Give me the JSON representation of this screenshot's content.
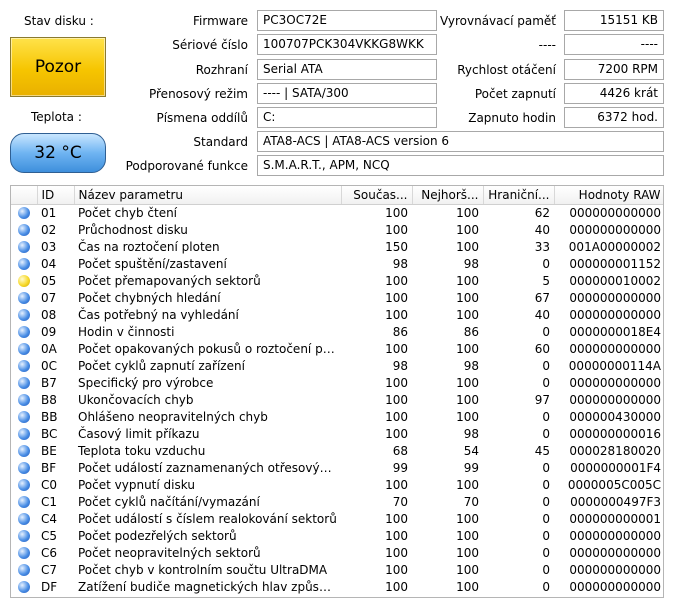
{
  "left_panel": {
    "status_label": "Stav disku :",
    "status_value": "Pozor",
    "temperature_label": "Teplota :",
    "temperature_value": "32 °C"
  },
  "info": {
    "firmware": {
      "label": "Firmware",
      "value": "PC3OC72E"
    },
    "serial": {
      "label": "Sériové číslo",
      "value": "100707PCK304VKKG8WKK"
    },
    "interface": {
      "label": "Rozhraní",
      "value": "Serial ATA"
    },
    "transfer_mode": {
      "label": "Přenosový režim",
      "value": "---- | SATA/300"
    },
    "drive_letter": {
      "label": "Písmena oddílů",
      "value": "C:"
    },
    "standard": {
      "label": "Standard",
      "value": "ATA8-ACS | ATA8-ACS version 6"
    },
    "features": {
      "label": "Podporované funkce",
      "value": "S.M.A.R.T., APM, NCQ"
    },
    "buffer": {
      "label": "Vyrovnávací paměť",
      "value": "15151 KB"
    },
    "blank_label": "----",
    "blank_value": "----",
    "rotation": {
      "label": "Rychlost otáčení",
      "value": "7200 RPM"
    },
    "power_count": {
      "label": "Počet zapnutí",
      "value": "4426 krát"
    },
    "power_hours": {
      "label": "Zapnuto hodin",
      "value": "6372 hod."
    }
  },
  "table": {
    "headers": {
      "id": "ID",
      "name": "Název parametru",
      "current": "Součas...",
      "worst": "Nejhorš...",
      "threshold": "Hraniční...",
      "raw": "Hodnoty RAW"
    },
    "rows": [
      {
        "status": "blue",
        "id": "01",
        "name": "Počet chyb čtení",
        "current": "100",
        "worst": "100",
        "threshold": "62",
        "raw": "000000000000"
      },
      {
        "status": "blue",
        "id": "02",
        "name": "Průchodnost disku",
        "current": "100",
        "worst": "100",
        "threshold": "40",
        "raw": "000000000000"
      },
      {
        "status": "blue",
        "id": "03",
        "name": "Čas na roztočení ploten",
        "current": "150",
        "worst": "100",
        "threshold": "33",
        "raw": "001A00000002"
      },
      {
        "status": "blue",
        "id": "04",
        "name": "Počet spuštění/zastavení",
        "current": "98",
        "worst": "98",
        "threshold": "0",
        "raw": "000000001152"
      },
      {
        "status": "yellow",
        "id": "05",
        "name": "Počet přemapovaných sektorů",
        "current": "100",
        "worst": "100",
        "threshold": "5",
        "raw": "000000010002"
      },
      {
        "status": "blue",
        "id": "07",
        "name": "Počet chybných hledání",
        "current": "100",
        "worst": "100",
        "threshold": "67",
        "raw": "000000000000"
      },
      {
        "status": "blue",
        "id": "08",
        "name": "Čas potřebný na vyhledání",
        "current": "100",
        "worst": "100",
        "threshold": "40",
        "raw": "000000000000"
      },
      {
        "status": "blue",
        "id": "09",
        "name": "Hodin v činnosti",
        "current": "86",
        "worst": "86",
        "threshold": "0",
        "raw": "0000000018E4"
      },
      {
        "status": "blue",
        "id": "0A",
        "name": "Počet opakovaných pokusů o roztočení plot...",
        "current": "100",
        "worst": "100",
        "threshold": "60",
        "raw": "000000000000"
      },
      {
        "status": "blue",
        "id": "0C",
        "name": "Počet cyklů zapnutí zařízení",
        "current": "98",
        "worst": "98",
        "threshold": "0",
        "raw": "00000000114A"
      },
      {
        "status": "blue",
        "id": "B7",
        "name": "Specifický pro výrobce",
        "current": "100",
        "worst": "100",
        "threshold": "0",
        "raw": "000000000000"
      },
      {
        "status": "blue",
        "id": "B8",
        "name": "Ukončovacích chyb",
        "current": "100",
        "worst": "100",
        "threshold": "97",
        "raw": "000000000000"
      },
      {
        "status": "blue",
        "id": "BB",
        "name": "Ohlášeno neopravitelných chyb",
        "current": "100",
        "worst": "100",
        "threshold": "0",
        "raw": "000000430000"
      },
      {
        "status": "blue",
        "id": "BC",
        "name": "Časový limit příkazu",
        "current": "100",
        "worst": "98",
        "threshold": "0",
        "raw": "000000000016"
      },
      {
        "status": "blue",
        "id": "BE",
        "name": "Teplota toku vzduchu",
        "current": "68",
        "worst": "54",
        "threshold": "45",
        "raw": "000028180020"
      },
      {
        "status": "blue",
        "id": "BF",
        "name": "Počet událostí zaznamenaných otřesovým ...",
        "current": "99",
        "worst": "99",
        "threshold": "0",
        "raw": "0000000001F4"
      },
      {
        "status": "blue",
        "id": "C0",
        "name": "Počet vypnutí disku",
        "current": "100",
        "worst": "100",
        "threshold": "0",
        "raw": "0000005C005C"
      },
      {
        "status": "blue",
        "id": "C1",
        "name": "Počet cyklů načítání/vymazání",
        "current": "70",
        "worst": "70",
        "threshold": "0",
        "raw": "0000000497F3"
      },
      {
        "status": "blue",
        "id": "C4",
        "name": "Počet událostí s číslem realokování sektorů",
        "current": "100",
        "worst": "100",
        "threshold": "0",
        "raw": "000000000001"
      },
      {
        "status": "blue",
        "id": "C5",
        "name": "Počet podezřelých sektorů",
        "current": "100",
        "worst": "100",
        "threshold": "0",
        "raw": "000000000000"
      },
      {
        "status": "blue",
        "id": "C6",
        "name": "Počet neopravitelných sektorů",
        "current": "100",
        "worst": "100",
        "threshold": "0",
        "raw": "000000000000"
      },
      {
        "status": "blue",
        "id": "C7",
        "name": "Počet chyb v kontrolním součtu UltraDMA",
        "current": "100",
        "worst": "100",
        "threshold": "0",
        "raw": "000000000000"
      },
      {
        "status": "blue",
        "id": "DF",
        "name": "Zatížení budiče magnetických hlav způsobe...",
        "current": "100",
        "worst": "100",
        "threshold": "0",
        "raw": "000000000000"
      }
    ]
  }
}
